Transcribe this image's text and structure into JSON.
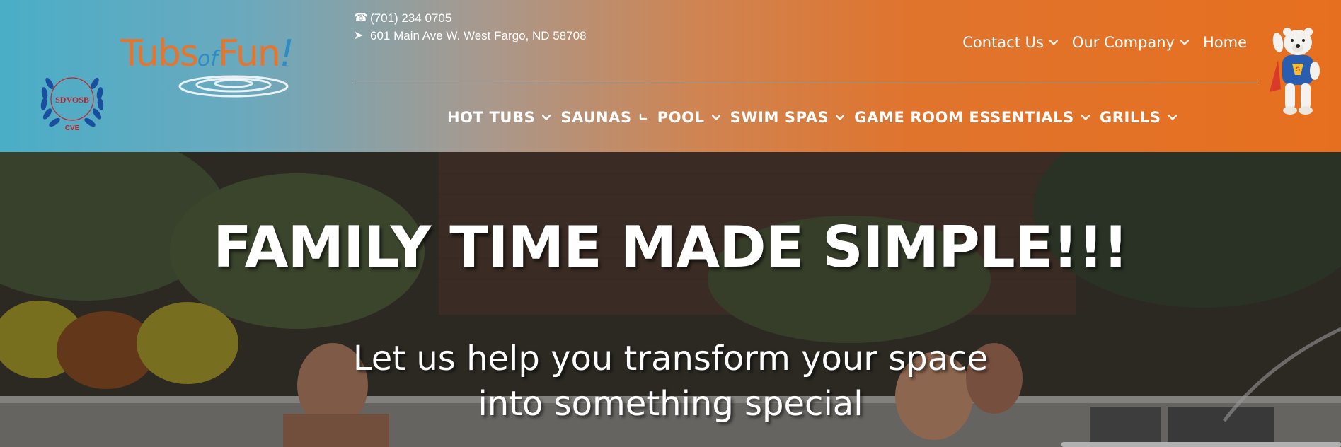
{
  "colors": {
    "header_left": "#4aaec7",
    "header_right": "#e66f1f",
    "logo_orange": "#e8742a",
    "logo_blue": "#2e8bc3",
    "badge_red": "#c8202a",
    "badge_blue": "#1a4fa0"
  },
  "badge": {
    "text": "SDVOSB",
    "subtext": "CVE"
  },
  "logo": {
    "part1": "Tubs",
    "part2": "of",
    "part3": "Fun",
    "part4": "!"
  },
  "contact": {
    "phone_icon": "phone-icon",
    "phone": "(701) 234 0705",
    "address_icon": "arrow-icon",
    "address": "601 Main Ave W. West Fargo, ND 58708"
  },
  "top_nav": [
    {
      "label": "Contact Us",
      "has_dropdown": true
    },
    {
      "label": "Our Company",
      "has_dropdown": true
    },
    {
      "label": "Home",
      "has_dropdown": false
    }
  ],
  "main_nav": [
    {
      "label": "HOT TUBS",
      "has_dropdown": true
    },
    {
      "label": "SAUNAS",
      "has_dropdown": true
    },
    {
      "label": "POOL",
      "has_dropdown": true
    },
    {
      "label": "SWIM SPAS",
      "has_dropdown": true
    },
    {
      "label": "GAME ROOM ESSENTIALS",
      "has_dropdown": true
    },
    {
      "label": "GRILLS",
      "has_dropdown": true
    }
  ],
  "hero": {
    "title": "FAMILY TIME MADE SIMPLE!!!",
    "subtitle_line1": "Let us help you transform your space",
    "subtitle_line2": "into something special"
  }
}
